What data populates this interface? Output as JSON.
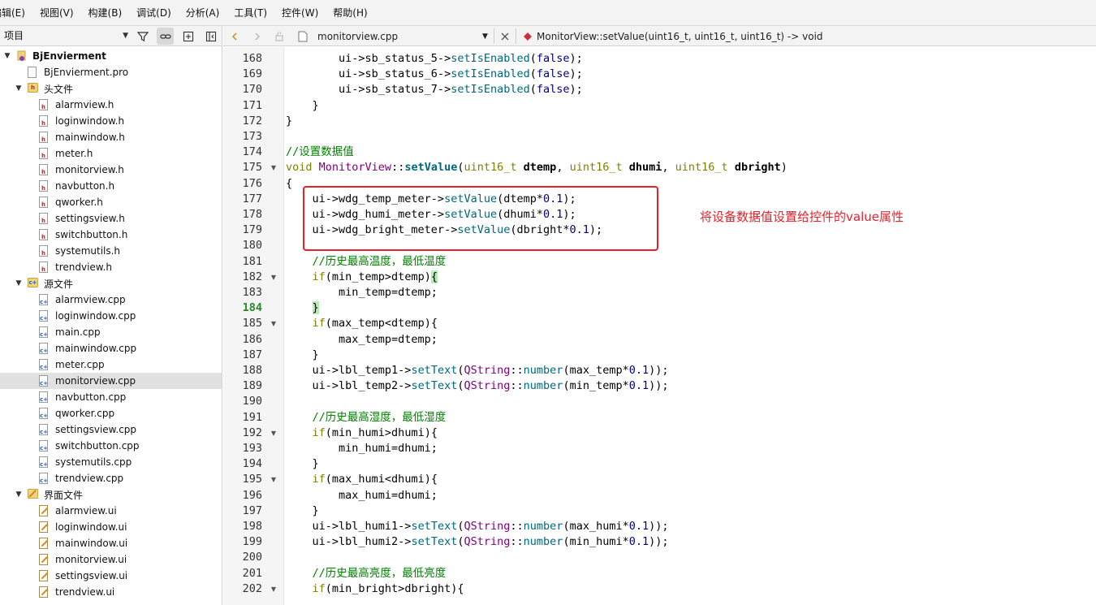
{
  "menu": [
    "编辑(E)",
    "视图(V)",
    "构建(B)",
    "调试(D)",
    "分析(A)",
    "工具(T)",
    "控件(W)",
    "帮助(H)"
  ],
  "project_panel": {
    "combo_label": "项目",
    "tree": [
      {
        "label": "BjEnvierment",
        "kind": "project",
        "expanded": true,
        "level": 0,
        "bold": true
      },
      {
        "label": "BjEnvierment.pro",
        "kind": "pro",
        "level": 1
      },
      {
        "label": "头文件",
        "kind": "folder-h",
        "expanded": true,
        "level": 1
      },
      {
        "label": "alarmview.h",
        "kind": "h",
        "level": 2
      },
      {
        "label": "loginwindow.h",
        "kind": "h",
        "level": 2
      },
      {
        "label": "mainwindow.h",
        "kind": "h",
        "level": 2
      },
      {
        "label": "meter.h",
        "kind": "h",
        "level": 2
      },
      {
        "label": "monitorview.h",
        "kind": "h",
        "level": 2
      },
      {
        "label": "navbutton.h",
        "kind": "h",
        "level": 2
      },
      {
        "label": "qworker.h",
        "kind": "h",
        "level": 2
      },
      {
        "label": "settingsview.h",
        "kind": "h",
        "level": 2
      },
      {
        "label": "switchbutton.h",
        "kind": "h",
        "level": 2
      },
      {
        "label": "systemutils.h",
        "kind": "h",
        "level": 2
      },
      {
        "label": "trendview.h",
        "kind": "h",
        "level": 2
      },
      {
        "label": "源文件",
        "kind": "folder-cpp",
        "expanded": true,
        "level": 1
      },
      {
        "label": "alarmview.cpp",
        "kind": "cpp",
        "level": 2
      },
      {
        "label": "loginwindow.cpp",
        "kind": "cpp",
        "level": 2
      },
      {
        "label": "main.cpp",
        "kind": "cpp",
        "level": 2
      },
      {
        "label": "mainwindow.cpp",
        "kind": "cpp",
        "level": 2
      },
      {
        "label": "meter.cpp",
        "kind": "cpp",
        "level": 2
      },
      {
        "label": "monitorview.cpp",
        "kind": "cpp",
        "level": 2,
        "selected": true
      },
      {
        "label": "navbutton.cpp",
        "kind": "cpp",
        "level": 2
      },
      {
        "label": "qworker.cpp",
        "kind": "cpp",
        "level": 2
      },
      {
        "label": "settingsview.cpp",
        "kind": "cpp",
        "level": 2
      },
      {
        "label": "switchbutton.cpp",
        "kind": "cpp",
        "level": 2
      },
      {
        "label": "systemutils.cpp",
        "kind": "cpp",
        "level": 2
      },
      {
        "label": "trendview.cpp",
        "kind": "cpp",
        "level": 2
      },
      {
        "label": "界面文件",
        "kind": "folder-ui",
        "expanded": true,
        "level": 1
      },
      {
        "label": "alarmview.ui",
        "kind": "ui",
        "level": 2
      },
      {
        "label": "loginwindow.ui",
        "kind": "ui",
        "level": 2
      },
      {
        "label": "mainwindow.ui",
        "kind": "ui",
        "level": 2
      },
      {
        "label": "monitorview.ui",
        "kind": "ui",
        "level": 2
      },
      {
        "label": "settingsview.ui",
        "kind": "ui",
        "level": 2
      },
      {
        "label": "trendview.ui",
        "kind": "ui",
        "level": 2
      }
    ]
  },
  "editor_toolbar": {
    "file_name": "monitorview.cpp",
    "symbol": "MonitorView::setValue(uint16_t, uint16_t, uint16_t) -> void"
  },
  "editor": {
    "current_line": 184,
    "lines": [
      {
        "n": 168,
        "fold": false,
        "code": [
          [
            "        ui->sb_status_5->",
            ""
          ],
          [
            "setIsEnabled",
            "fn"
          ],
          [
            "(",
            ""
          ],
          [
            "false",
            "bool"
          ],
          [
            ");",
            ""
          ]
        ]
      },
      {
        "n": 169,
        "fold": false,
        "code": [
          [
            "        ui->sb_status_6->",
            ""
          ],
          [
            "setIsEnabled",
            "fn"
          ],
          [
            "(",
            ""
          ],
          [
            "false",
            "bool"
          ],
          [
            ");",
            ""
          ]
        ]
      },
      {
        "n": 170,
        "fold": false,
        "code": [
          [
            "        ui->sb_status_7->",
            ""
          ],
          [
            "setIsEnabled",
            "fn"
          ],
          [
            "(",
            ""
          ],
          [
            "false",
            "bool"
          ],
          [
            ");",
            ""
          ]
        ]
      },
      {
        "n": 171,
        "fold": false,
        "code": [
          [
            "    }",
            ""
          ]
        ]
      },
      {
        "n": 172,
        "fold": false,
        "code": [
          [
            "}",
            ""
          ]
        ]
      },
      {
        "n": 173,
        "fold": false,
        "code": []
      },
      {
        "n": 174,
        "fold": false,
        "code": [
          [
            "//",
            "cmt"
          ],
          [
            "设置数据值",
            "cmt-cn"
          ]
        ]
      },
      {
        "n": 175,
        "fold": true,
        "code": [
          [
            "void",
            "kw"
          ],
          [
            " ",
            ""
          ],
          [
            "MonitorView",
            "typ"
          ],
          [
            "::",
            ""
          ],
          [
            "setValue",
            "bfn"
          ],
          [
            "(",
            ""
          ],
          [
            "uint16_t",
            "kw"
          ],
          [
            " ",
            ""
          ],
          [
            "dtemp",
            "bp"
          ],
          [
            ", ",
            ""
          ],
          [
            "uint16_t",
            "kw"
          ],
          [
            " ",
            ""
          ],
          [
            "dhumi",
            "bp"
          ],
          [
            ", ",
            ""
          ],
          [
            "uint16_t",
            "kw"
          ],
          [
            " ",
            ""
          ],
          [
            "dbright",
            "bp"
          ],
          [
            ")",
            ""
          ]
        ]
      },
      {
        "n": 176,
        "fold": false,
        "code": [
          [
            "{",
            ""
          ]
        ]
      },
      {
        "n": 177,
        "fold": false,
        "code": [
          [
            "    ui->wdg_temp_meter->",
            ""
          ],
          [
            "setValue",
            "fn"
          ],
          [
            "(dtemp*",
            ""
          ],
          [
            "0.1",
            "num"
          ],
          [
            ");",
            ""
          ]
        ]
      },
      {
        "n": 178,
        "fold": false,
        "code": [
          [
            "    ui->wdg_humi_meter->",
            ""
          ],
          [
            "setValue",
            "fn"
          ],
          [
            "(dhumi*",
            ""
          ],
          [
            "0.1",
            "num"
          ],
          [
            ");",
            ""
          ]
        ]
      },
      {
        "n": 179,
        "fold": false,
        "code": [
          [
            "    ui->wdg_bright_meter->",
            ""
          ],
          [
            "setValue",
            "fn"
          ],
          [
            "(dbright*",
            ""
          ],
          [
            "0.1",
            "num"
          ],
          [
            ");",
            ""
          ]
        ]
      },
      {
        "n": 180,
        "fold": false,
        "code": []
      },
      {
        "n": 181,
        "fold": false,
        "code": [
          [
            "    //",
            "cmt"
          ],
          [
            "历史最高温度，最低温度",
            "cmt-cn"
          ]
        ]
      },
      {
        "n": 182,
        "fold": true,
        "code": [
          [
            "    ",
            ""
          ],
          [
            "if",
            "kw"
          ],
          [
            "(min_temp>dtemp)",
            ""
          ],
          [
            "{",
            "hl"
          ]
        ]
      },
      {
        "n": 183,
        "fold": false,
        "code": [
          [
            "        min_temp=dtemp;",
            ""
          ]
        ]
      },
      {
        "n": 184,
        "fold": false,
        "code": [
          [
            "    ",
            ""
          ],
          [
            "}",
            "hl"
          ]
        ]
      },
      {
        "n": 185,
        "fold": true,
        "code": [
          [
            "    ",
            ""
          ],
          [
            "if",
            "kw"
          ],
          [
            "(max_temp<dtemp){",
            ""
          ]
        ]
      },
      {
        "n": 186,
        "fold": false,
        "code": [
          [
            "        max_temp=dtemp;",
            ""
          ]
        ]
      },
      {
        "n": 187,
        "fold": false,
        "code": [
          [
            "    }",
            ""
          ]
        ]
      },
      {
        "n": 188,
        "fold": false,
        "code": [
          [
            "    ui->lbl_temp1->",
            ""
          ],
          [
            "setText",
            "fn"
          ],
          [
            "(",
            ""
          ],
          [
            "QString",
            "typ"
          ],
          [
            "::",
            ""
          ],
          [
            "number",
            "fn"
          ],
          [
            "(max_temp*",
            ""
          ],
          [
            "0.1",
            "num"
          ],
          [
            "));",
            ""
          ]
        ]
      },
      {
        "n": 189,
        "fold": false,
        "code": [
          [
            "    ui->lbl_temp2->",
            ""
          ],
          [
            "setText",
            "fn"
          ],
          [
            "(",
            ""
          ],
          [
            "QString",
            "typ"
          ],
          [
            "::",
            ""
          ],
          [
            "number",
            "fn"
          ],
          [
            "(min_temp*",
            ""
          ],
          [
            "0.1",
            "num"
          ],
          [
            "));",
            ""
          ]
        ]
      },
      {
        "n": 190,
        "fold": false,
        "code": []
      },
      {
        "n": 191,
        "fold": false,
        "code": [
          [
            "    //",
            "cmt"
          ],
          [
            "历史最高湿度，最低湿度",
            "cmt-cn"
          ]
        ]
      },
      {
        "n": 192,
        "fold": true,
        "code": [
          [
            "    ",
            ""
          ],
          [
            "if",
            "kw"
          ],
          [
            "(min_humi>dhumi){",
            ""
          ]
        ]
      },
      {
        "n": 193,
        "fold": false,
        "code": [
          [
            "        min_humi=dhumi;",
            ""
          ]
        ]
      },
      {
        "n": 194,
        "fold": false,
        "code": [
          [
            "    }",
            ""
          ]
        ]
      },
      {
        "n": 195,
        "fold": true,
        "code": [
          [
            "    ",
            ""
          ],
          [
            "if",
            "kw"
          ],
          [
            "(max_humi<dhumi){",
            ""
          ]
        ]
      },
      {
        "n": 196,
        "fold": false,
        "code": [
          [
            "        max_humi=dhumi;",
            ""
          ]
        ]
      },
      {
        "n": 197,
        "fold": false,
        "code": [
          [
            "    }",
            ""
          ]
        ]
      },
      {
        "n": 198,
        "fold": false,
        "code": [
          [
            "    ui->lbl_humi1->",
            ""
          ],
          [
            "setText",
            "fn"
          ],
          [
            "(",
            ""
          ],
          [
            "QString",
            "typ"
          ],
          [
            "::",
            ""
          ],
          [
            "number",
            "fn"
          ],
          [
            "(max_humi*",
            ""
          ],
          [
            "0.1",
            "num"
          ],
          [
            "));",
            ""
          ]
        ]
      },
      {
        "n": 199,
        "fold": false,
        "code": [
          [
            "    ui->lbl_humi2->",
            ""
          ],
          [
            "setText",
            "fn"
          ],
          [
            "(",
            ""
          ],
          [
            "QString",
            "typ"
          ],
          [
            "::",
            ""
          ],
          [
            "number",
            "fn"
          ],
          [
            "(min_humi*",
            ""
          ],
          [
            "0.1",
            "num"
          ],
          [
            "));",
            ""
          ]
        ]
      },
      {
        "n": 200,
        "fold": false,
        "code": []
      },
      {
        "n": 201,
        "fold": false,
        "code": [
          [
            "    //",
            "cmt"
          ],
          [
            "历史最高亮度，最低亮度",
            "cmt-cn"
          ]
        ]
      },
      {
        "n": 202,
        "fold": true,
        "code": [
          [
            "    ",
            ""
          ],
          [
            "if",
            "kw"
          ],
          [
            "(min_bright>dbright){",
            ""
          ]
        ]
      }
    ]
  },
  "annotation": {
    "text": "将设备数据值设置给控件的value属性",
    "color": "#e8202a"
  },
  "colors": {
    "keyword": "#808000",
    "function": "#00677c",
    "type": "#800080",
    "comment": "#008000",
    "number": "#000080",
    "bracket_highlight": "#b4eeb4",
    "selection_row": "#e1e1e1"
  },
  "icons": {
    "filter": "filter-icon",
    "link": "link-icon",
    "split": "split-add-icon",
    "close_pane": "close-pane-icon",
    "back": "chevron-left-icon",
    "forward": "chevron-right-icon",
    "lock": "lock-icon",
    "file": "cpp-file-icon",
    "close": "close-icon",
    "symbol": "function-diamond-icon"
  }
}
